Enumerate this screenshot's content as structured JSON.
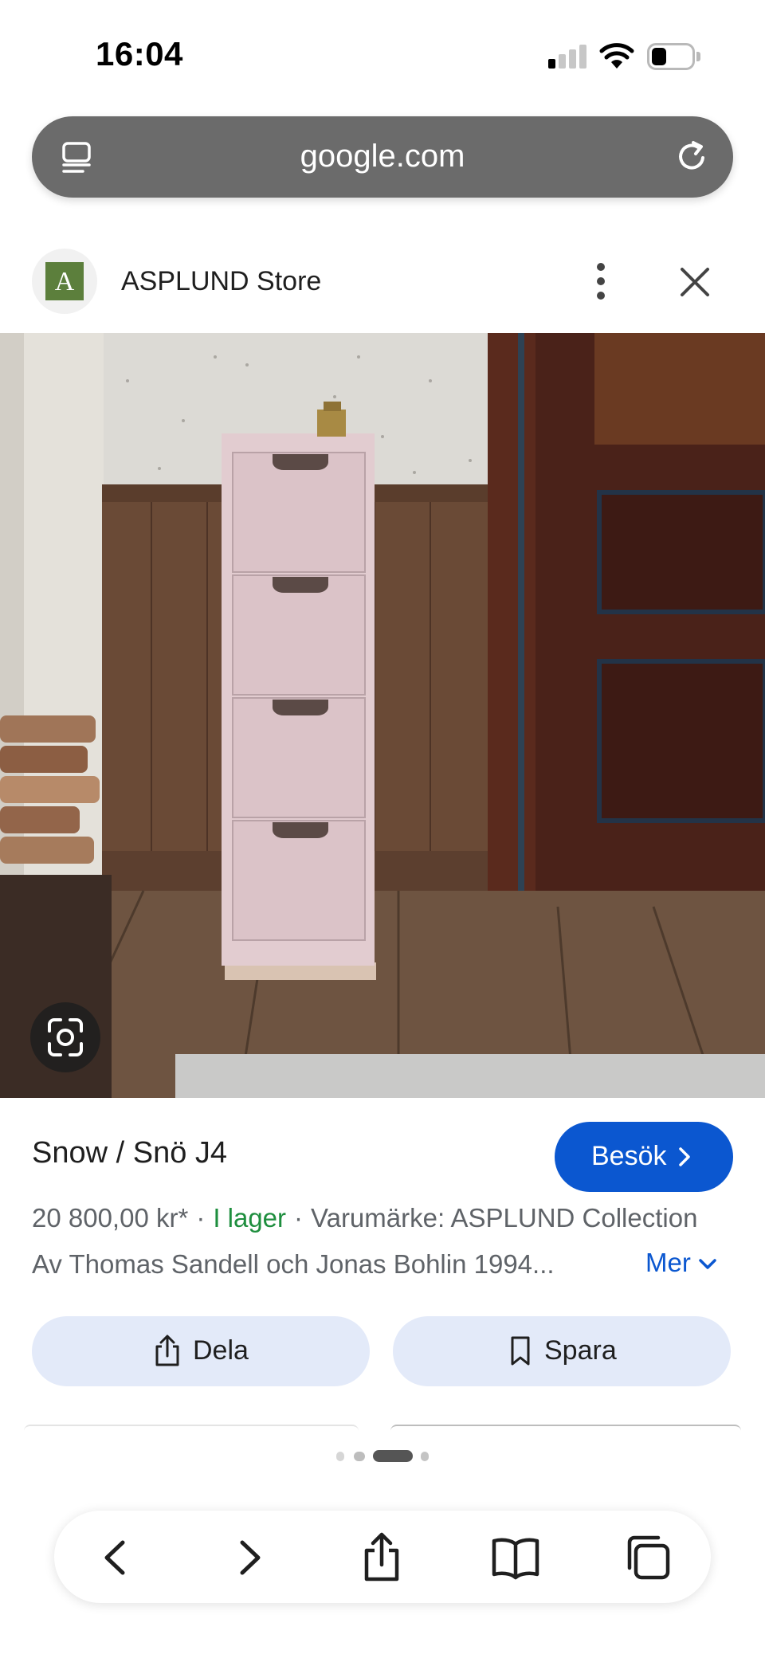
{
  "status_bar": {
    "time": "16:04"
  },
  "browser": {
    "url": "google.com"
  },
  "store": {
    "logo_letter": "A",
    "name": "ASPLUND Store"
  },
  "product": {
    "title": "Snow / Snö J4",
    "visit_label": "Besök",
    "price": "20 800,00 kr*",
    "stock": "I lager",
    "brand": "Varumärke: ASPLUND Collection",
    "separator": "·",
    "description": "Av Thomas Sandell och Jonas Bohlin 1994...",
    "more_label": "Mer"
  },
  "actions": {
    "share_label": "Dela",
    "save_label": "Spara"
  },
  "carousel": {
    "page_count": 4,
    "active_index": 2
  },
  "colors": {
    "accent": "#0b57d0",
    "in_stock": "#1e8e3e",
    "pill_bg": "#e3eaf9",
    "url_bar_bg": "#6b6b6b"
  },
  "icons": {
    "tabs": "tab-overview-icon",
    "reload": "reload-icon",
    "more": "more-vert-icon",
    "close": "close-icon",
    "lens": "lens-icon",
    "share": "share-icon",
    "bookmark": "bookmark-icon",
    "back": "back-icon",
    "forward": "forward-icon",
    "bookmarks": "book-icon",
    "tabs_bottom": "tabs-icon"
  }
}
